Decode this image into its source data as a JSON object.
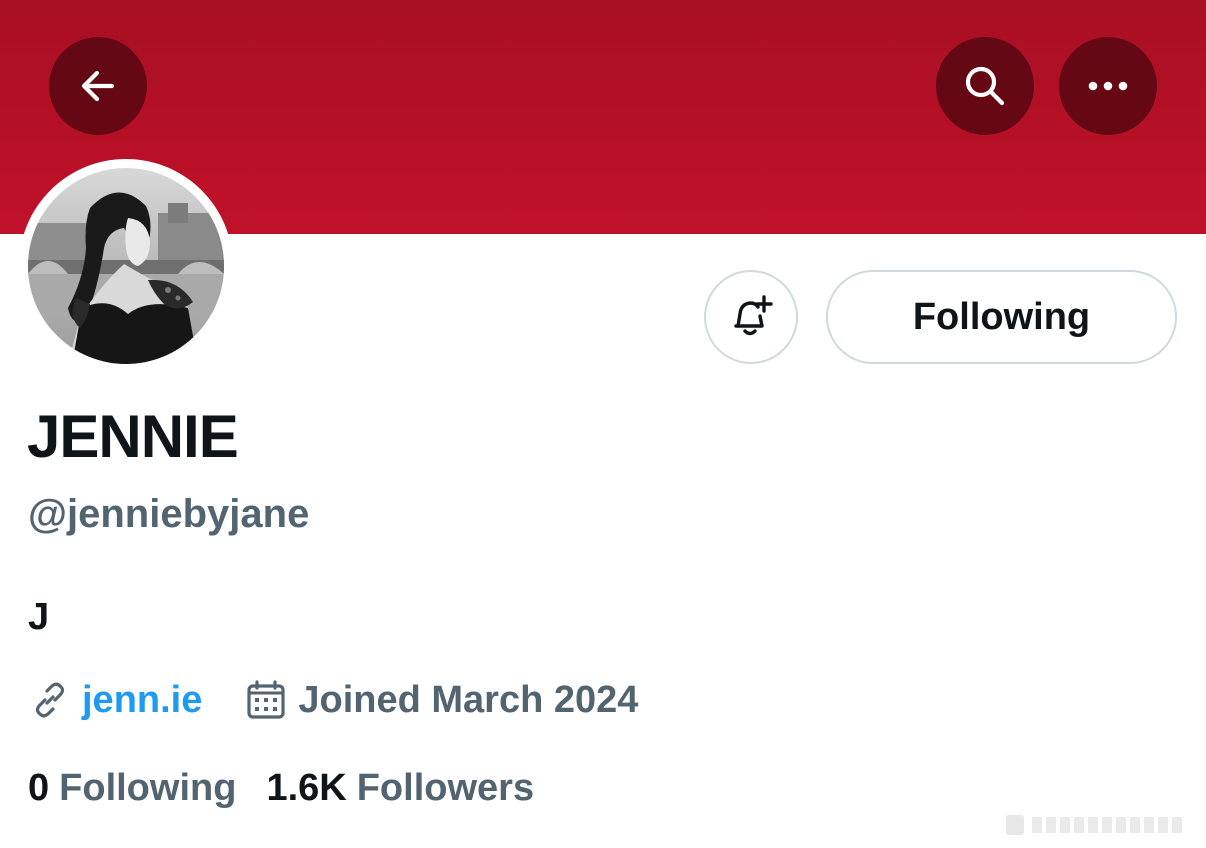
{
  "header": {
    "banner_color": "#b8112a",
    "back_icon": "arrow-left-icon",
    "search_icon": "search-icon",
    "more_icon": "more-horizontal-icon"
  },
  "profile": {
    "display_name": "JENNIE",
    "handle": "@jenniebyjane",
    "bio": "J",
    "link_text": "jenn.ie",
    "joined": "Joined March 2024",
    "following_count": "0",
    "following_label": "Following",
    "followers_count": "1.6K",
    "followers_label": "Followers"
  },
  "actions": {
    "notify_icon": "bell-plus-icon",
    "following_button_label": "Following"
  },
  "colors": {
    "link": "#1d9bf0",
    "muted": "#536471",
    "text": "#0f1419",
    "border": "#cfd9de"
  }
}
